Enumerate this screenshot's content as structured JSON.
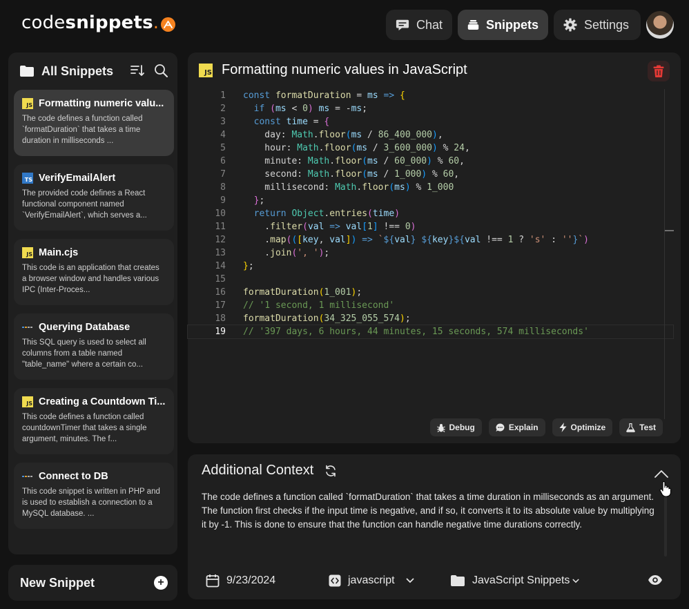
{
  "app": {
    "logo_light": "code",
    "logo_bold": "snippets",
    "logo_dot": "."
  },
  "nav": {
    "chat": "Chat",
    "snippets": "Snippets",
    "settings": "Settings"
  },
  "sidebar": {
    "title": "All Snippets",
    "cards": [
      {
        "icon": "js",
        "title": "Formatting numeric valu...",
        "desc": "The code defines a function called `formatDuration` that takes a time duration in milliseconds ..."
      },
      {
        "icon": "ts",
        "title": "VerifyEmailAlert",
        "desc": "The provided code defines a React functional component named `VerifyEmailAlert`, which serves a..."
      },
      {
        "icon": "js",
        "title": "Main.cjs",
        "desc": "This code is an application that creates a browser window and handles various IPC (Inter-Proces..."
      },
      {
        "icon": "db",
        "title": "Querying Database",
        "desc": "This SQL query is used to select all columns from a table named \"table_name\" where a certain co..."
      },
      {
        "icon": "js",
        "title": "Creating a Countdown Ti...",
        "desc": "This code defines a function called countdownTimer that takes a single argument, minutes. The f..."
      },
      {
        "icon": "db",
        "title": "Connect to DB",
        "desc": "This code snippet is written in PHP and is used to establish a connection to a MySQL database. ..."
      }
    ],
    "new_snippet": "New Snippet"
  },
  "editor": {
    "title": "Formatting numeric values in JavaScript",
    "icon_label": "JS",
    "current_line": 19,
    "actions": {
      "debug": "Debug",
      "explain": "Explain",
      "optimize": "Optimize",
      "test": "Test"
    }
  },
  "context": {
    "title": "Additional Context",
    "body": "The code defines a function called `formatDuration` that takes a time duration in milliseconds as an argument. The function first checks if the input time is negative, and if so, it converts it to its absolute value by multiplying it by -1. This is done to ensure that the function can handle negative time durations correctly.",
    "date": "9/23/2024",
    "language": "javascript",
    "folder": "JavaScript Snippets"
  },
  "colors": {
    "accent": "#f6821f",
    "danger": "#e53935",
    "js_badge": "#f0db4f",
    "ts_badge": "#3178c6"
  }
}
